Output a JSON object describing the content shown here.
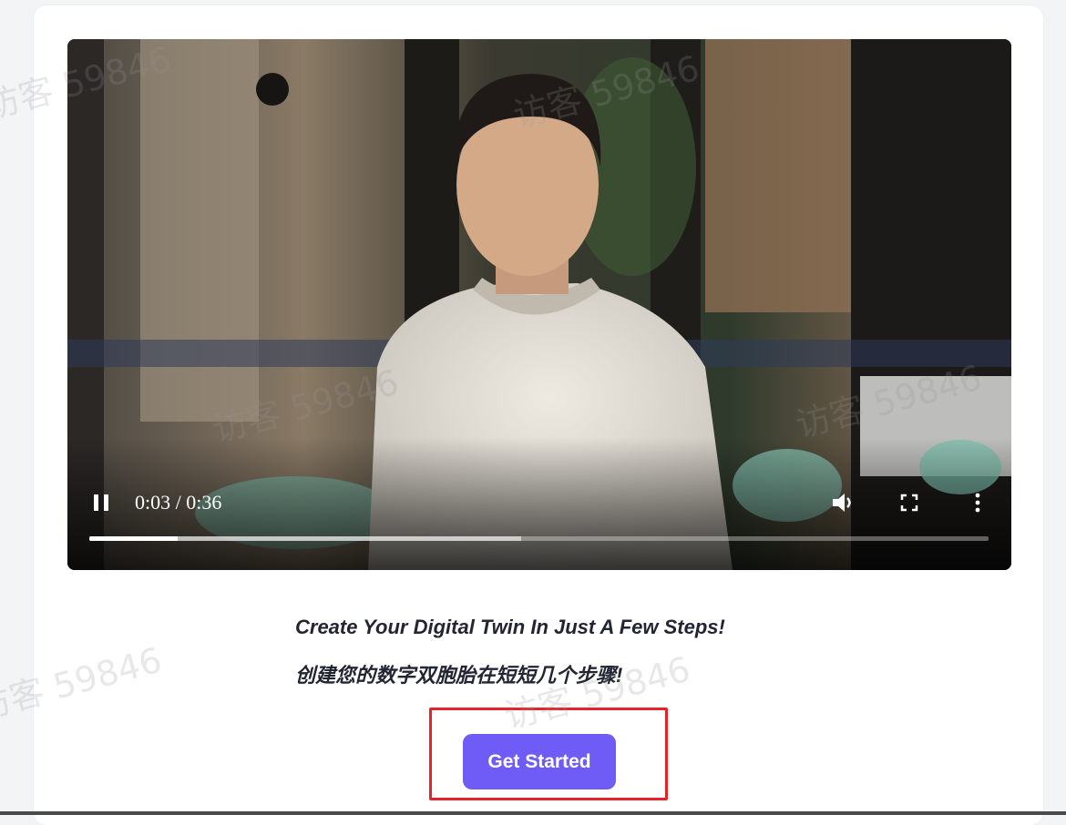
{
  "video": {
    "time_display": "0:03 / 0:36",
    "played_fraction": 0.098,
    "buffered_fraction": 0.48,
    "icons": [
      "pause-icon",
      "volume-icon",
      "fullscreen-icon",
      "more-options-icon"
    ]
  },
  "content": {
    "headline_en": "Create Your Digital Twin In Just A Few Steps!",
    "headline_cn": "创建您的数字双胞胎在短短几个步骤!"
  },
  "cta": {
    "label": "Get Started",
    "color": "#6f5cf6"
  },
  "watermark": {
    "text": "访客 59846"
  },
  "colors": {
    "highlight": "#e5242a",
    "card": "#ffffff",
    "background": "#f3f4f6"
  }
}
